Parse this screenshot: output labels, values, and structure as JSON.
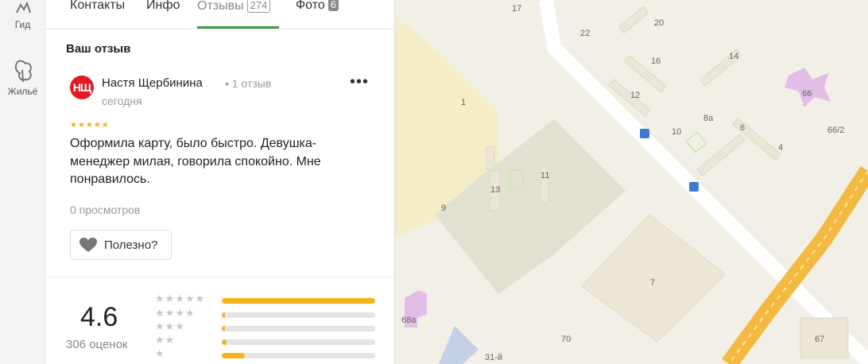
{
  "rail": {
    "items": [
      {
        "label": "Гид",
        "icon": "guide-icon"
      },
      {
        "label": "Жильё",
        "icon": "lodging-icon"
      }
    ]
  },
  "tabs": [
    {
      "label": "Контакты"
    },
    {
      "label": "Инфо"
    },
    {
      "label": "Отзывы",
      "count": "274"
    },
    {
      "label": "Фото",
      "count": "6"
    }
  ],
  "review_section": {
    "title": "Ваш отзыв"
  },
  "review": {
    "avatar_initials": "НЩ",
    "author": "Настя Щербинина",
    "meta": "• 1 отзыв",
    "date": "сегодня",
    "rating": 5,
    "stars": "★★★★★",
    "text": "Оформила карту, было быстро. Девушка-менеджер милая, говорила спокойно. Мне понравилось.",
    "views": "0 просмотров",
    "helpful_label": "Полезно?"
  },
  "rating_summary": {
    "value": "4.6",
    "count_text": "306 оценок",
    "distribution": [
      {
        "stars": "★★★★★",
        "fraction": 1.0
      },
      {
        "stars": "★★★★",
        "fraction": 0.02
      },
      {
        "stars": "★★★",
        "fraction": 0.02
      },
      {
        "stars": "★★",
        "fraction": 0.03
      },
      {
        "stars": "★",
        "fraction": 0.15
      }
    ]
  },
  "map": {
    "labels": [
      "17",
      "22",
      "20",
      "16",
      "14",
      "12",
      "66",
      "1",
      "8а",
      "10",
      "6",
      "66/2",
      "4",
      "13",
      "11",
      "9",
      "7",
      "68а",
      "70",
      "67",
      "31-й"
    ],
    "colors": {
      "ground": "#f2efe6",
      "building": "#ebe6d6",
      "building_edge": "#ddd7c5",
      "road": "#ffffff",
      "highway": "#f3b940",
      "plaza": "#e3e0d2",
      "park": "#c8e6b0",
      "block": "#f5ecc8",
      "highlight": "#e2bde8",
      "water": "#c4cfe8",
      "transit": "#3a7ad6"
    }
  }
}
